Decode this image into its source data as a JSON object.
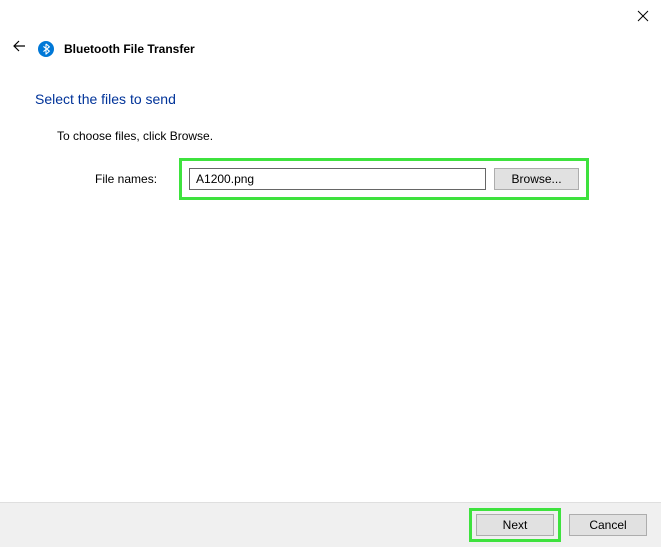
{
  "window": {
    "title": "Bluetooth File Transfer"
  },
  "page": {
    "heading": "Select the files to send",
    "instruction": "To choose files, click Browse.",
    "file_label": "File names:",
    "file_value": "A1200.png",
    "browse_label": "Browse..."
  },
  "footer": {
    "next_label": "Next",
    "cancel_label": "Cancel"
  }
}
